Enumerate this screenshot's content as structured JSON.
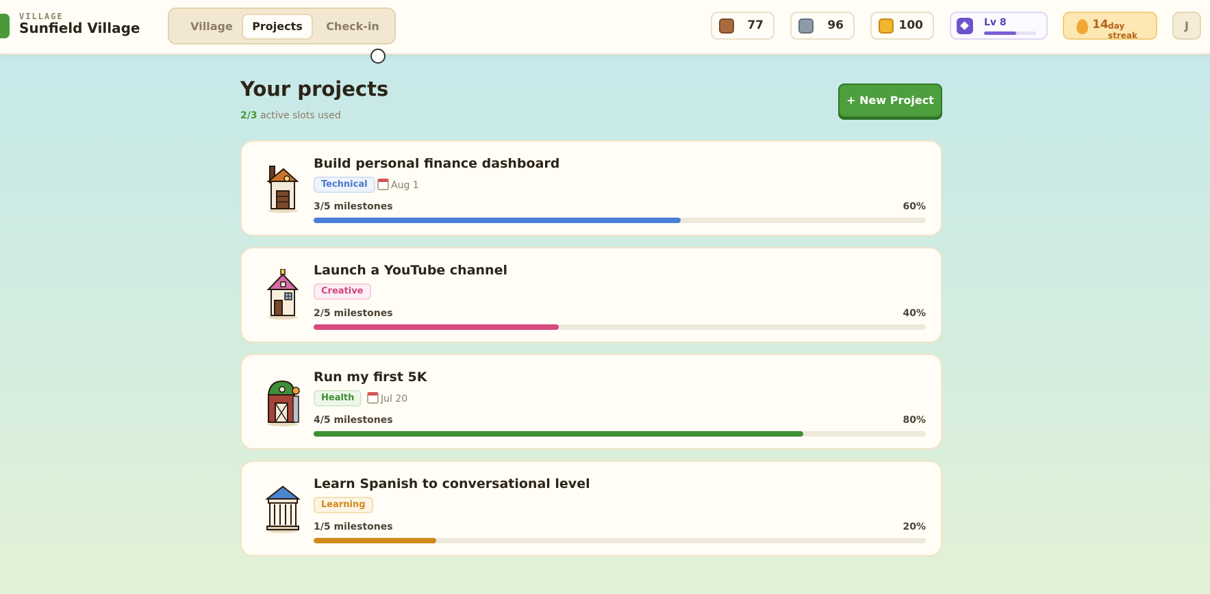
{
  "header": {
    "brand_kicker": "VILLAGE",
    "brand_title": "Sunfield Village",
    "tabs": [
      {
        "label": "Village",
        "active": false
      },
      {
        "label": "Projects",
        "active": true
      },
      {
        "label": "Check-in",
        "active": false
      }
    ],
    "resources": [
      {
        "icon": "wood-icon",
        "value": "77",
        "color": "#a86a3e"
      },
      {
        "icon": "stone-icon",
        "value": "96",
        "color": "#8f9aa8"
      },
      {
        "icon": "gold-icon",
        "value": "100",
        "color": "#f1b52e"
      }
    ],
    "level": {
      "label": "Lv 8",
      "progress": 0.62
    },
    "streak": {
      "count": "14",
      "label": "day streak"
    },
    "avatar_initial": "J"
  },
  "main": {
    "title": "Your projects",
    "slots_used": "2/3",
    "slots_label": "active slots used",
    "new_project_label": "+ New Project"
  },
  "projects": [
    {
      "title": "Build personal finance dashboard",
      "tag": "Technical",
      "due": "Aug 1",
      "milestones": "3/5 milestones",
      "percent": "60%",
      "progress": 0.6,
      "color": "#4a7ed6"
    },
    {
      "title": "Launch a YouTube channel",
      "tag": "Creative",
      "milestones": "2/5 milestones",
      "percent": "40%",
      "progress": 0.4,
      "color": "#d64a7e"
    },
    {
      "title": "Run my first 5K",
      "tag": "Health",
      "due": "Jul 20",
      "milestones": "4/5 milestones",
      "percent": "80%",
      "progress": 0.8,
      "color": "#3f8f35"
    },
    {
      "title": "Learn Spanish to conversational level",
      "tag": "Learning",
      "milestones": "1/5 milestones",
      "percent": "20%",
      "progress": 0.2,
      "color": "#d08a1c"
    }
  ]
}
